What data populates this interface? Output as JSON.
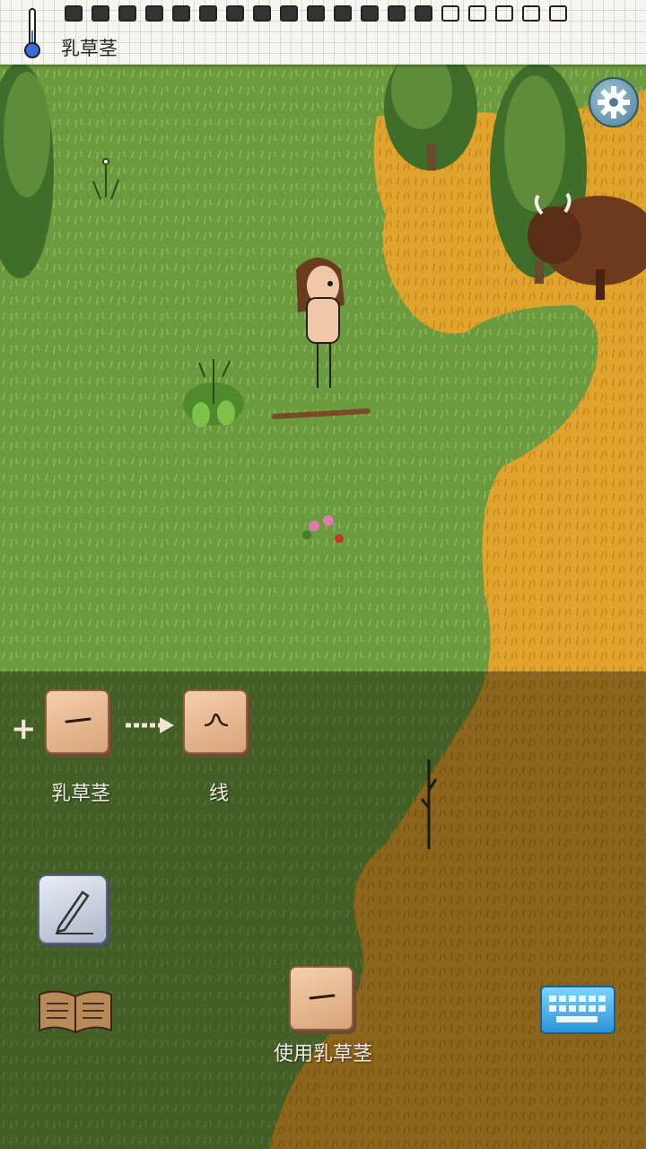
{
  "hud": {
    "held_item": "乳草茎",
    "food_full": 14,
    "food_total": 19
  },
  "recipe": {
    "input_label": "乳草茎",
    "output_label": "线"
  },
  "action": {
    "use_label": "使用乳草茎"
  },
  "icons": {
    "settings": "gear-icon",
    "pencil": "pencil-icon",
    "book": "book-icon",
    "keyboard": "keyboard-icon",
    "thermometer": "thermometer-icon"
  },
  "colors": {
    "grass": "#6c9a3e",
    "dry_grass": "#e0a830",
    "tile": "#e9bb92"
  }
}
